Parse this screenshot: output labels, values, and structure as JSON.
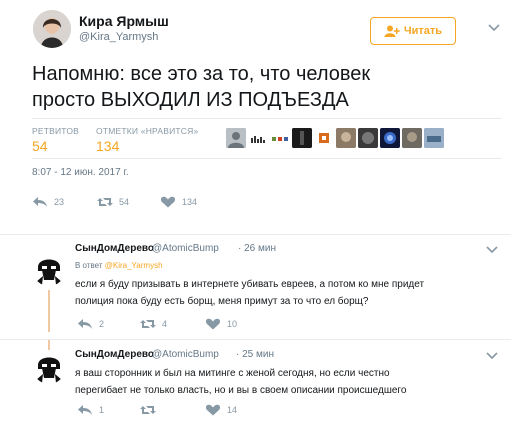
{
  "main_tweet": {
    "author_name": "Кира Ярмыш",
    "author_handle": "@Kira_Yarmysh",
    "follow_label": "Читать",
    "text_line1": "Напомню: все это за то, что человек",
    "text_line2": "просто ВЫХОДИЛ ИЗ ПОДЪЕЗДА",
    "retweets_label": "РЕТВИТОВ",
    "retweets_count": "54",
    "likes_label": "ОТМЕТКИ «НРАВИТСЯ»",
    "likes_count": "134",
    "timestamp": "8:07 - 12 июн. 2017 г.",
    "actions": {
      "reply_count": "23",
      "retweet_count": "54",
      "like_count": "134"
    }
  },
  "replies": [
    {
      "name": "СынДомДерево",
      "handle": "@AtomicBump",
      "time": "· 26 мин",
      "reply_to_prefix": "В ответ",
      "reply_to_mention": "@Kira_Yarmysh",
      "text_line1": "если я буду призывать в интернете убивать евреев, а потом ко мне придет",
      "text_line2": "полиция пока буду есть борщ, меня примут за то что ел борщ?",
      "reply_count": "2",
      "retweet_count": "4",
      "like_count": "10"
    },
    {
      "name": "СынДомДерево",
      "handle": "@AtomicBump",
      "time": "· 25 мин",
      "text_line1": "я ваш сторонник и был на митинге с женой сегодня, но если честно",
      "text_line2": "перегибает не только власть, но и вы в своем описании происшедшего",
      "reply_count": "1",
      "retweet_count": "",
      "like_count": "14"
    }
  ],
  "colors": {
    "accent": "#f5a623",
    "muted": "#657786",
    "text": "#14171a",
    "divider": "#e6ecf0"
  },
  "icons": [
    "reply-icon",
    "retweet-icon",
    "heart-icon",
    "follow-person-icon",
    "chevron-down-icon"
  ]
}
